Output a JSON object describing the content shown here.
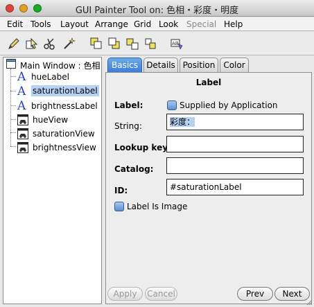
{
  "window": {
    "title": "GUI Painter Tool on: 色相・彩度・明度"
  },
  "menu": [
    "Edit",
    "Tools",
    "Layout",
    "Arrange",
    "Grid",
    "Look",
    "Special",
    "Help"
  ],
  "toolbar": {
    "icons": [
      "pencil-icon",
      "select-icon",
      "scissors-icon",
      "wand-icon",
      "bring-front-icon",
      "send-back-icon",
      "align-icon",
      "group-icon",
      "ab-component-icon"
    ]
  },
  "tree": {
    "root": "Main Window : 色相",
    "items": [
      {
        "label": "hueLabel",
        "kind": "label",
        "selected": false
      },
      {
        "label": "saturationLabel",
        "kind": "label",
        "selected": true
      },
      {
        "label": "brightnessLabel",
        "kind": "label",
        "selected": false
      },
      {
        "label": "hueView",
        "kind": "view",
        "selected": false
      },
      {
        "label": "saturationView",
        "kind": "view",
        "selected": false
      },
      {
        "label": "brightnessView",
        "kind": "view",
        "selected": false
      }
    ]
  },
  "tabs": [
    {
      "label": "Basics",
      "active": true
    },
    {
      "label": "Details",
      "active": false
    },
    {
      "label": "Position",
      "active": false
    },
    {
      "label": "Color",
      "active": false
    }
  ],
  "basics": {
    "heading": "Label",
    "label_caption": "Label:",
    "supplied_label": "Supplied by Application",
    "string_caption": "String:",
    "string_value": "彩度：",
    "lookup_caption": "Lookup key:",
    "lookup_value": "",
    "catalog_caption": "Catalog:",
    "catalog_value": "",
    "id_caption": "ID:",
    "id_value": "#saturationLabel",
    "label_is_image": "Label Is Image"
  },
  "buttons": {
    "apply": "Apply",
    "cancel": "Cancel",
    "prev": "Prev",
    "next": "Next"
  },
  "colors": {
    "selection": "#b5d2f5",
    "tab_active": "#3c7fd8"
  }
}
